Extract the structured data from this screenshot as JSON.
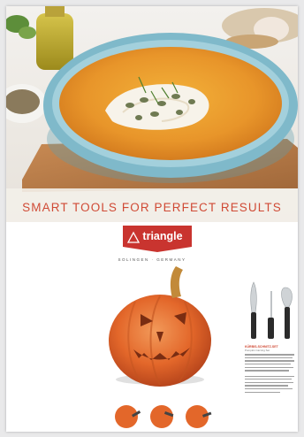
{
  "document": {
    "tagline": "SMART TOOLS FOR PERFECT RESULTS",
    "brand": "triangle",
    "origin": "SOLINGEN · GERMANY",
    "product_heading": "KÜRBIS-SCHNITZ-SET",
    "product_subheading": "Pumpkin Carving Set"
  },
  "colors": {
    "accent_red": "#d04a35",
    "soup_orange": "#e89a22",
    "bowl_blue": "#79b7c8",
    "pumpkin": "#e8692b"
  }
}
